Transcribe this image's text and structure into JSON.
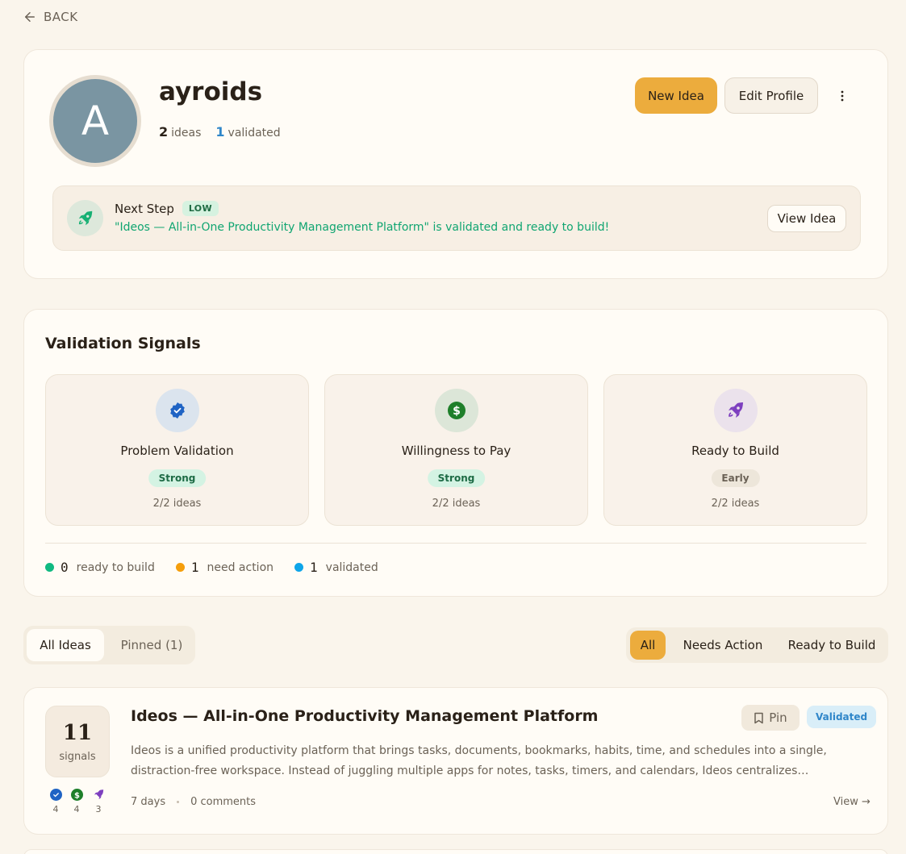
{
  "nav": {
    "back_label": "BACK"
  },
  "profile": {
    "avatar_letter": "A",
    "username": "ayroids",
    "ideas_count": "2",
    "ideas_label": "ideas",
    "validated_count": "1",
    "validated_label": "validated",
    "new_idea_label": "New Idea",
    "edit_profile_label": "Edit Profile"
  },
  "next_step": {
    "title": "Next Step",
    "badge": "LOW",
    "message": "\"Ideos — All-in-One Productivity Management Platform\" is validated and ready to build!",
    "button_label": "View Idea"
  },
  "validation": {
    "title": "Validation Signals",
    "signals": [
      {
        "label": "Problem Validation",
        "status": "Strong",
        "count": "2/2 ideas",
        "icon": "verified-badge-icon",
        "color": "#1f63c4"
      },
      {
        "label": "Willingness to Pay",
        "status": "Strong",
        "count": "2/2 ideas",
        "icon": "dollar-icon",
        "color": "#1e7f2a"
      },
      {
        "label": "Ready to Build",
        "status": "Early",
        "count": "2/2 ideas",
        "icon": "rocket-icon",
        "color": "#7d3fbf"
      }
    ],
    "legend": [
      {
        "count": "0",
        "label": "ready to build",
        "color": "#10b981"
      },
      {
        "count": "1",
        "label": "need action",
        "color": "#f59e0b"
      },
      {
        "count": "1",
        "label": "validated",
        "color": "#0ea5e9"
      }
    ]
  },
  "tabs": {
    "all": "All Ideas",
    "pinned": "Pinned (1)"
  },
  "filters": {
    "all": "All",
    "needs_action": "Needs Action",
    "ready": "Ready to Build"
  },
  "ideas": [
    {
      "score": "11",
      "score_label": "signals",
      "mini_counts": [
        "4",
        "4",
        "3"
      ],
      "title": "Ideos — All-in-One Productivity Management Platform",
      "pin_label": "Pin",
      "status": "Validated",
      "description": "Ideos is a unified productivity platform that brings tasks, documents, bookmarks, habits, time, and schedules into a single, distraction-free workspace. Instead of juggling multiple apps for notes, tasks, timers, and calendars, Ideos centralizes everything...",
      "age": "7 days",
      "comments": "0 comments",
      "view_label": "View →"
    }
  ]
}
